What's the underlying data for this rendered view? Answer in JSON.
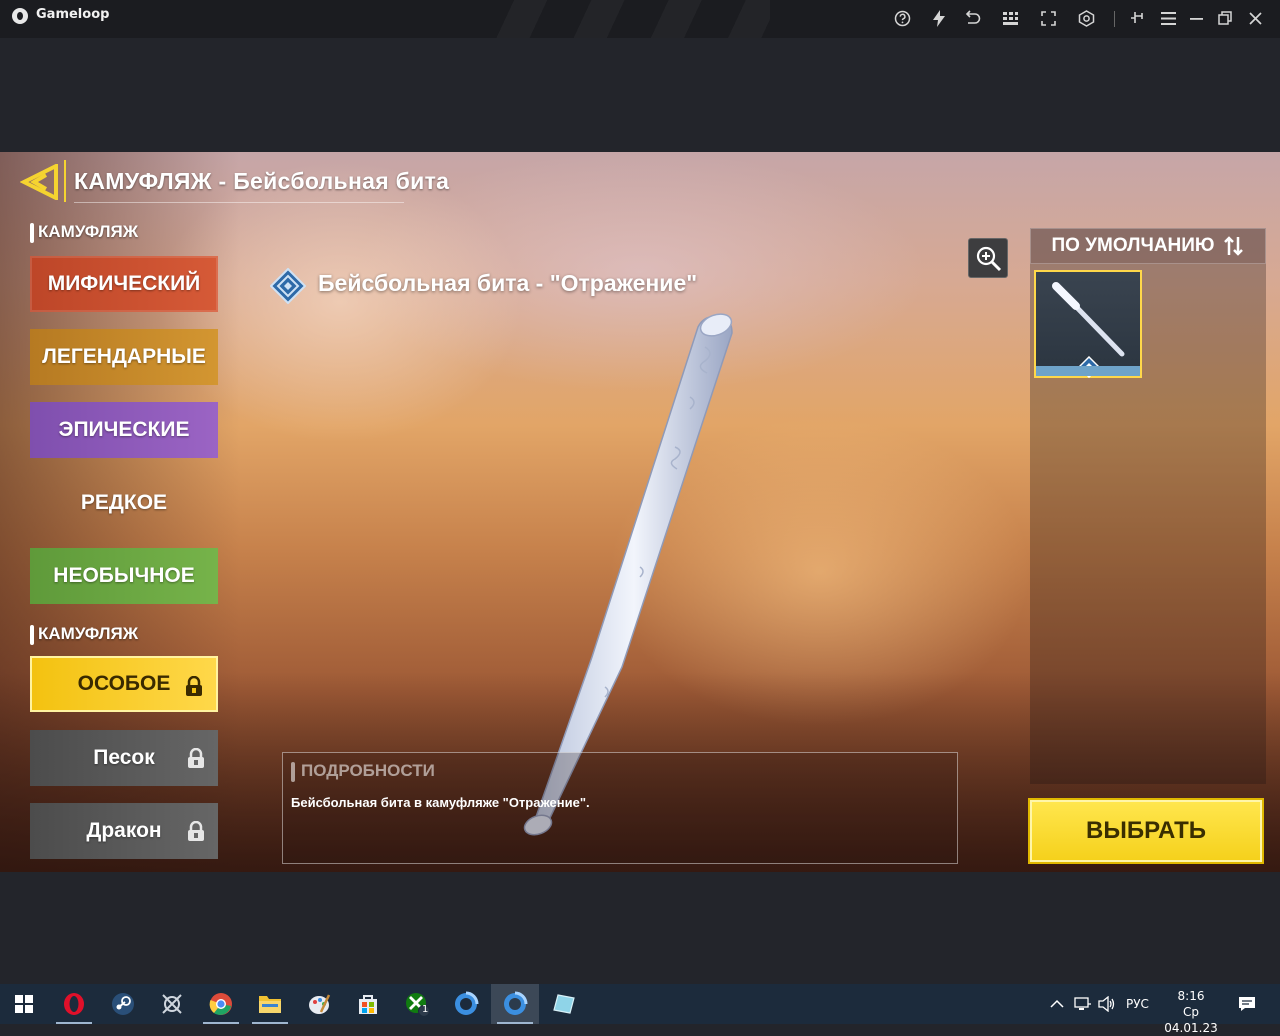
{
  "window": {
    "title": "Gameloop"
  },
  "game": {
    "page_title": "КАМУФЛЯЖ - Бейсбольная бита",
    "section_1_label": "КАМУФЛЯЖ",
    "section_2_label": "КАМУФЛЯЖ",
    "categories": [
      {
        "label": "МИФИЧЕСКИЙ"
      },
      {
        "label": "ЛЕГЕНДАРНЫЕ"
      },
      {
        "label": "ЭПИЧЕСКИЕ"
      },
      {
        "label": "РЕДКОЕ"
      },
      {
        "label": "НЕОБЫЧНОЕ"
      }
    ],
    "special_categories": [
      {
        "label": "ОСОБОЕ"
      },
      {
        "label": "Песок"
      },
      {
        "label": "Дракон"
      }
    ],
    "skin_name": "Бейсбольная бита - \"Отражение\"",
    "sort_label": "ПО УМОЛЧАНИЮ",
    "details_label": "ПОДРОБНОСТИ",
    "details_text": "Бейсбольная бита в камуфляже \"Отражение\".",
    "select_button": "ВЫБРАТЬ",
    "colors": {
      "accent_yellow": "#f5d430",
      "mythic": "#d65a37",
      "legendary": "#d39631",
      "epic": "#9b64c4",
      "uncommon": "#76b34a"
    }
  },
  "taskbar": {
    "language": "РУС",
    "time": "8:16",
    "date": "Ср 04.01.23",
    "xbox_badge": "1"
  }
}
